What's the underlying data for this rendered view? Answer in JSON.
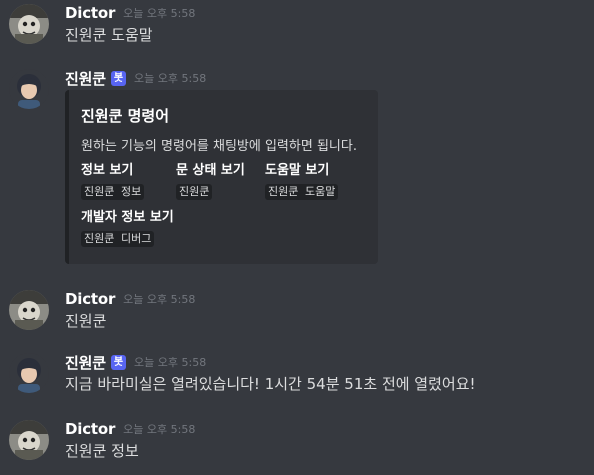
{
  "messages": [
    {
      "username": "Dictor",
      "timestamp": "오늘 오후 5:58",
      "content": "진원쿤 도움말",
      "avatar": "dictor-avatar"
    },
    {
      "username": "진원쿤",
      "bot_tag": "봇",
      "timestamp": "오늘 오후 5:58",
      "avatar": "jinwonkun-avatar",
      "embed": {
        "title": "진원쿤 명령어",
        "description": "원하는 기능의 명령어를 채팅방에 입력하면 됩니다.",
        "fields": [
          {
            "name": "정보 보기",
            "value": "진원쿤 정보"
          },
          {
            "name": "문 상태 보기",
            "value": "진원쿤"
          },
          {
            "name": "도움말 보기",
            "value": "진원쿤 도움말"
          },
          {
            "name": "개발자 정보 보기",
            "value": "진원쿤 디버그"
          }
        ]
      }
    },
    {
      "username": "Dictor",
      "timestamp": "오늘 오후 5:58",
      "content": "진원쿤",
      "avatar": "dictor-avatar"
    },
    {
      "username": "진원쿤",
      "bot_tag": "봇",
      "timestamp": "오늘 오후 5:58",
      "content": "지금 바라미실은 열려있습니다! 1시간 54분 51초 전에 열렸어요!",
      "avatar": "jinwonkun-avatar"
    },
    {
      "username": "Dictor",
      "timestamp": "오늘 오후 5:58",
      "content": "진원쿤 정보",
      "avatar": "dictor-avatar"
    }
  ],
  "colors": {
    "background": "#36393f",
    "embed_background": "#2f3136",
    "bot_tag": "#5865f2",
    "username": "#ffffff",
    "timestamp": "#72767d",
    "text": "#dcddde"
  }
}
